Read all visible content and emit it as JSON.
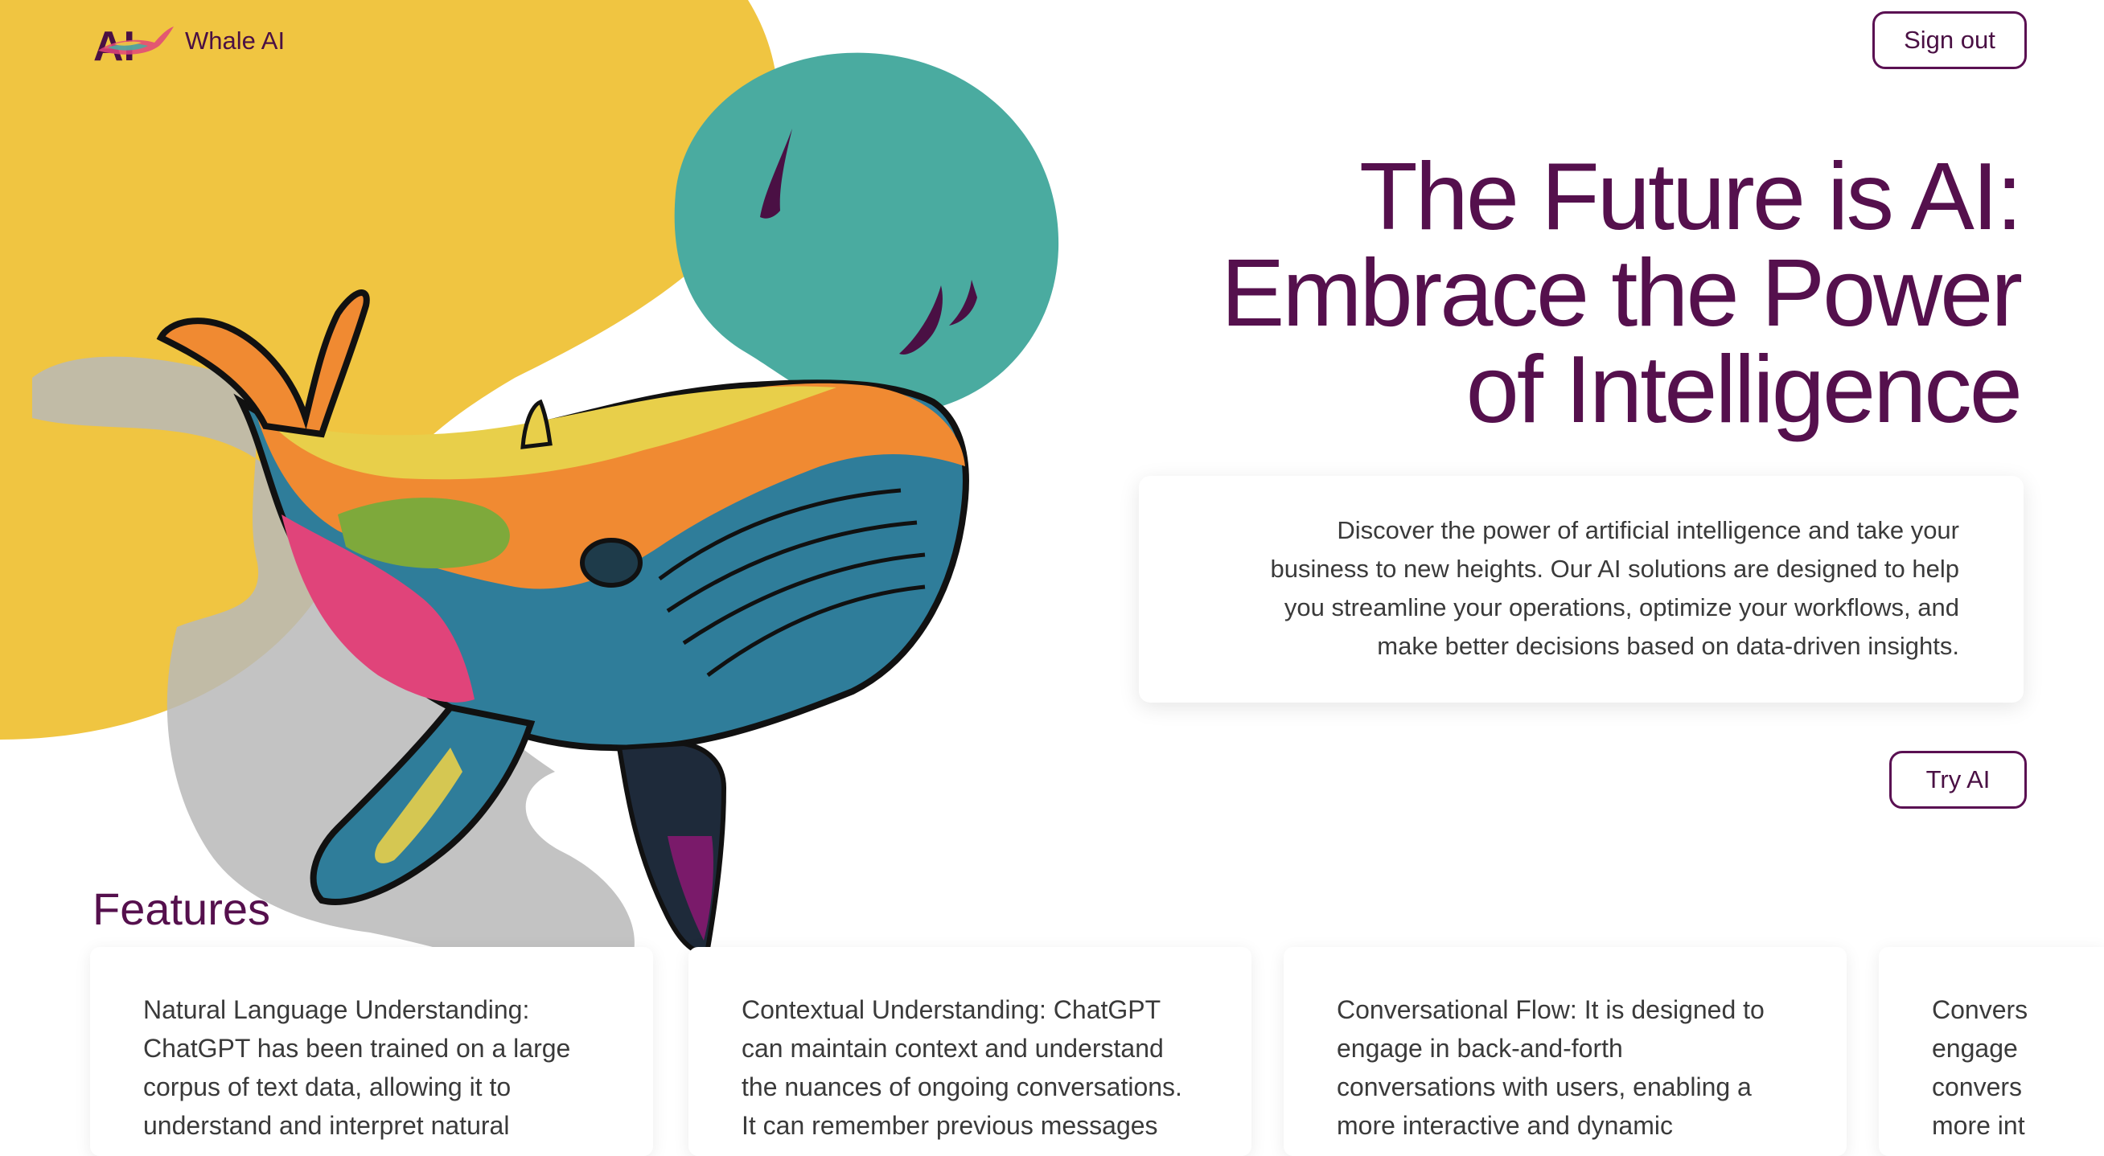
{
  "brand": {
    "logo_text": "AI",
    "name": "Whale AI"
  },
  "header": {
    "signout_label": "Sign out"
  },
  "hero": {
    "headline_line1": "The Future is AI:",
    "headline_line2": "Embrace the Power",
    "headline_line3": "of Intelligence",
    "description_line1": "Discover the power of artificial intelligence and take your",
    "description_line2": "business to new heights. Our AI solutions are designed to help",
    "description_line3": "you streamline your operations, optimize your workflows, and",
    "description_line4": "make better decisions based on data-driven insights.",
    "cta_label": "Try AI"
  },
  "features": {
    "title": "Features",
    "items": [
      {
        "lines": [
          "Natural Language Understanding:",
          "ChatGPT has been trained on a large",
          "corpus of text data, allowing it to",
          "understand and interpret natural"
        ]
      },
      {
        "lines": [
          "Contextual Understanding: ChatGPT",
          "can maintain context and understand",
          "the nuances of ongoing conversations.",
          "It can remember previous messages"
        ]
      },
      {
        "lines": [
          "Conversational Flow: It is designed to",
          "engage in back-and-forth",
          "conversations with users, enabling a",
          "more interactive and dynamic"
        ]
      },
      {
        "lines": [
          "Convers",
          "engage",
          "convers",
          "more int"
        ]
      }
    ]
  },
  "colors": {
    "primary": "#55104d",
    "blob_yellow": "#f0c541",
    "blob_teal": "#4aaba0",
    "whale_blue": "#2f7d9a",
    "whale_orange": "#f08a32",
    "whale_pink": "#e0447a"
  }
}
